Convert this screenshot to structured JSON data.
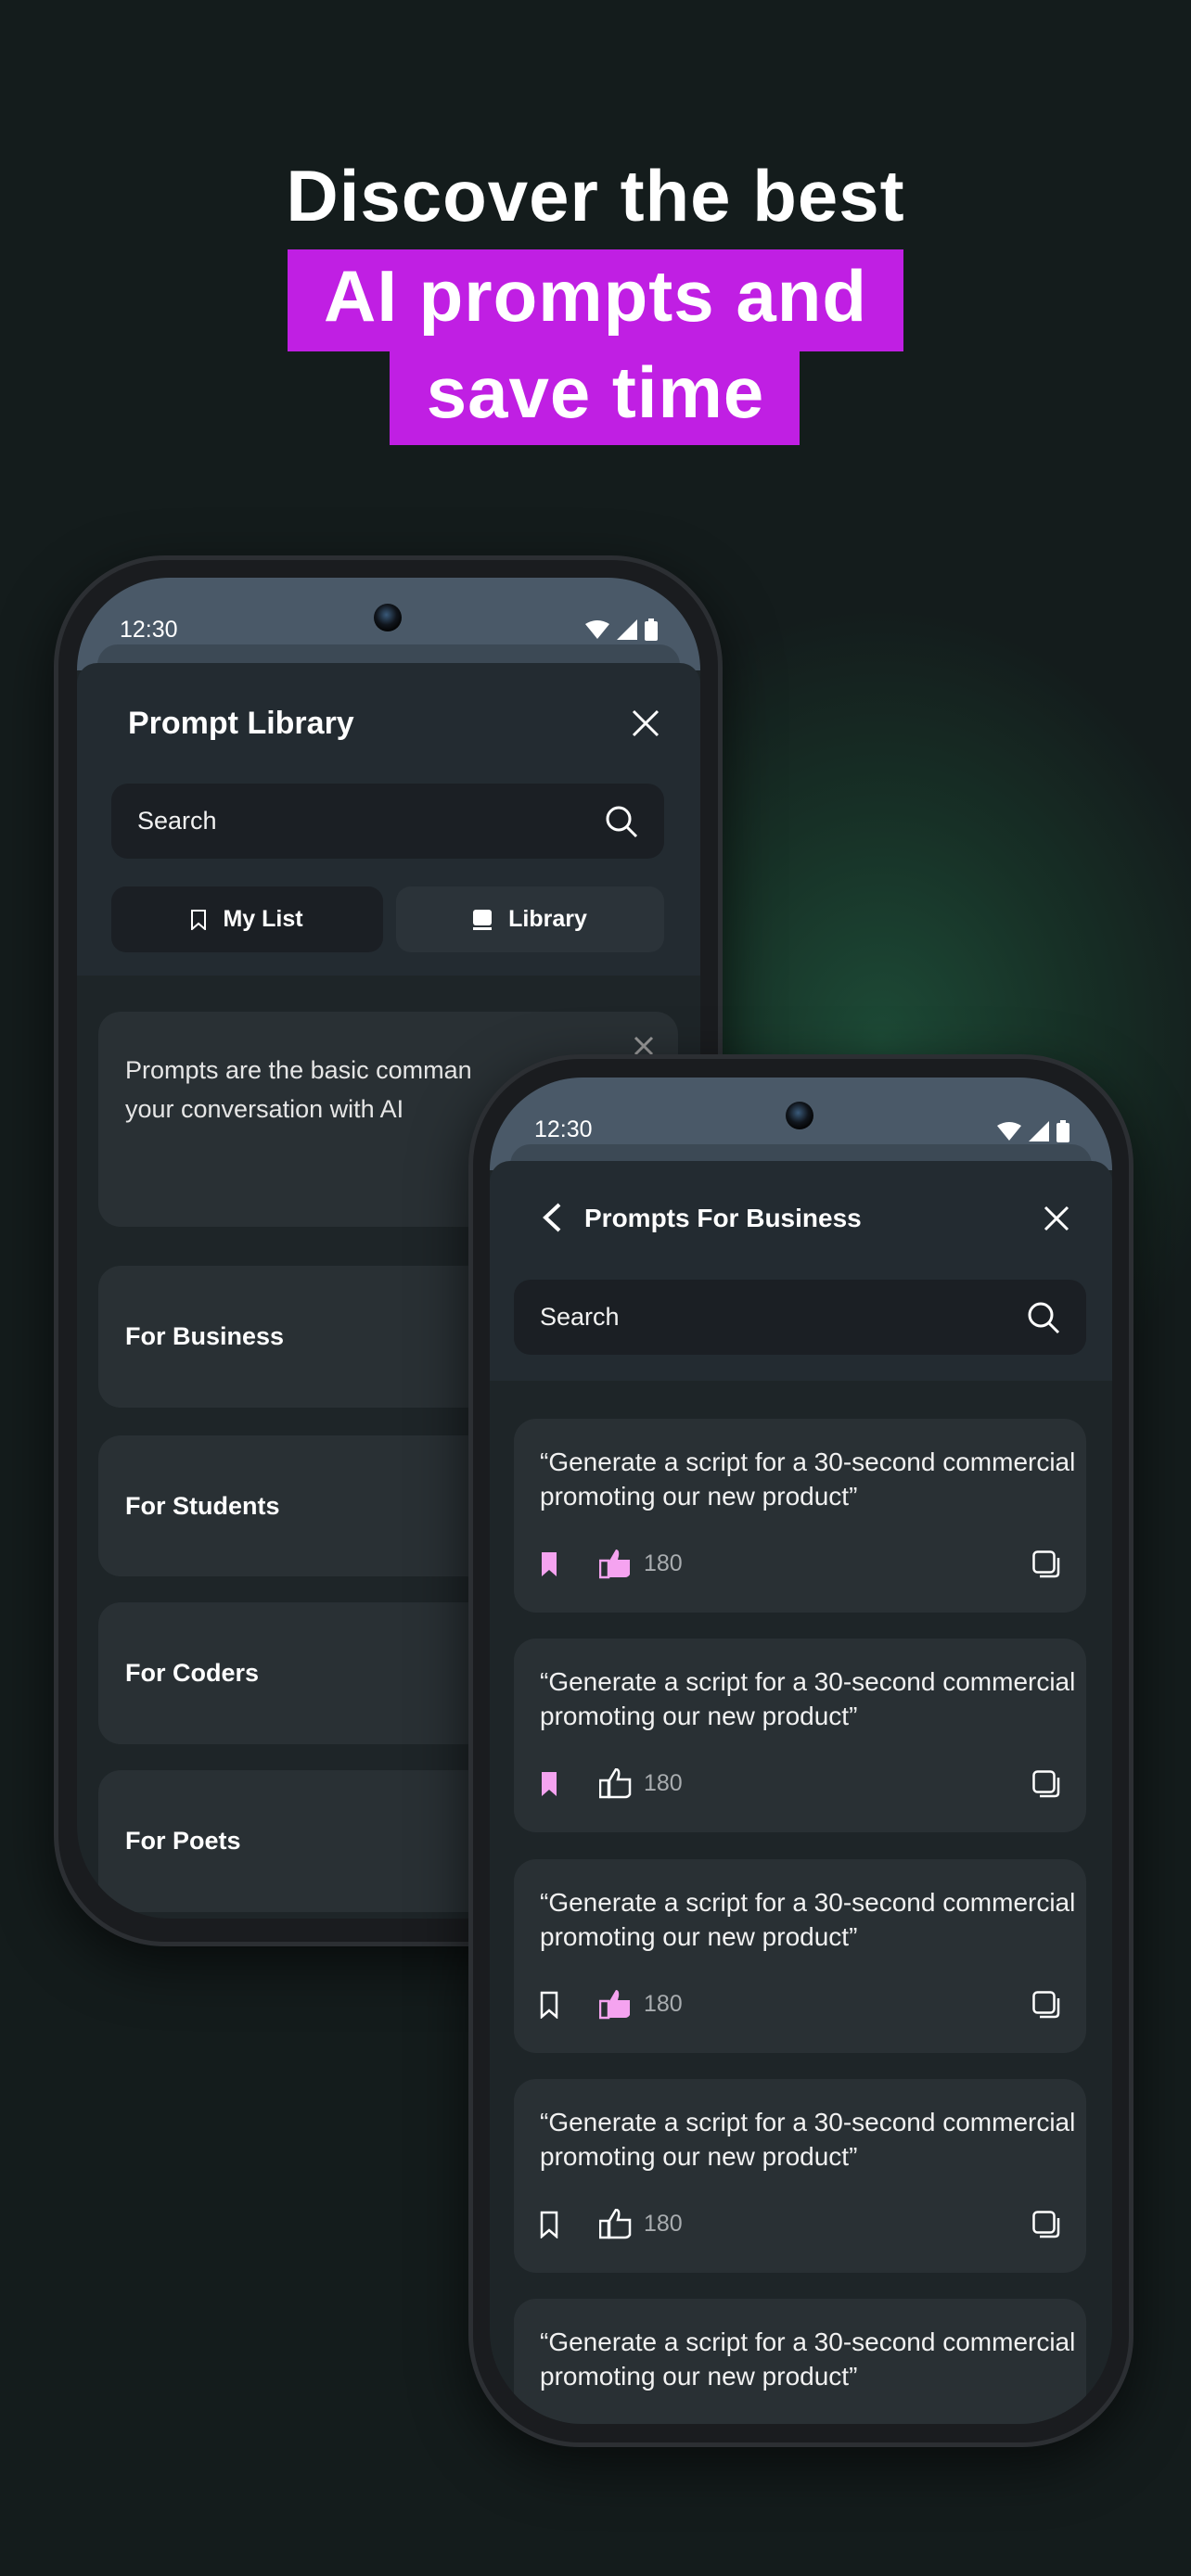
{
  "headline": {
    "line1": "Discover the best",
    "line2": "AI prompts and",
    "line3": "save time",
    "highlight_color": "#c01fe3"
  },
  "phone_left": {
    "status": {
      "time": "12:30",
      "icons": [
        "wifi-icon",
        "signal-icon",
        "battery-icon"
      ]
    },
    "title": "Prompt Library",
    "search_placeholder": "Search",
    "tabs": [
      {
        "label": "My List",
        "icon": "bookmark-icon"
      },
      {
        "label": "Library",
        "icon": "book-icon",
        "active": true
      }
    ],
    "info_text_line1": "Prompts are the basic comman",
    "info_text_line2": "your conversation with AI",
    "categories": [
      "For Business",
      "For Students",
      "For Coders",
      "For Poets"
    ]
  },
  "phone_right": {
    "status": {
      "time": "12:30",
      "icons": [
        "wifi-icon",
        "signal-icon",
        "battery-icon"
      ]
    },
    "title": "Prompts For Business",
    "search_placeholder": "Search",
    "accent": "#f5a3f0",
    "prompts": [
      {
        "text": "“Generate a script for a 30-second commercial promoting our new product”",
        "likes": "180",
        "bookmarked": true,
        "liked": true
      },
      {
        "text": "“Generate a script for a 30-second commercial promoting our new product”",
        "likes": "180",
        "bookmarked": true,
        "liked": false
      },
      {
        "text": "“Generate a script for a 30-second commercial promoting our new product”",
        "likes": "180",
        "bookmarked": false,
        "liked": true
      },
      {
        "text": "“Generate a script for a 30-second commercial promoting our new product”",
        "likes": "180",
        "bookmarked": false,
        "liked": false
      },
      {
        "text": "“Generate a script for a 30-second commercial promoting our new product”"
      }
    ]
  }
}
